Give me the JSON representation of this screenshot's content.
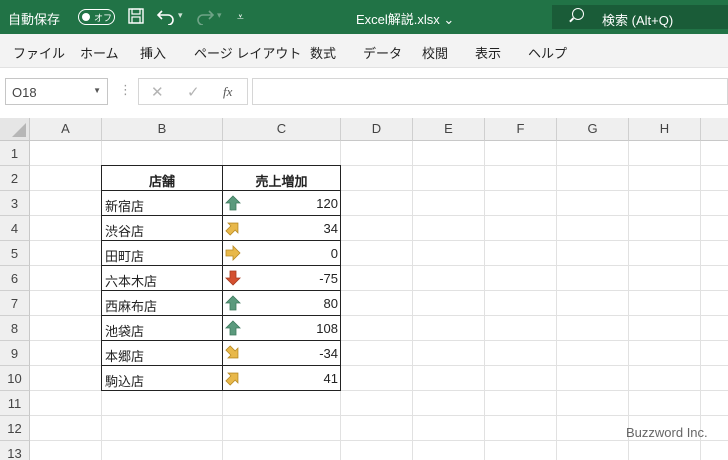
{
  "titlebar": {
    "autosave_label": "自動保存",
    "autosave_state": "オフ",
    "filename": "Excel解説.xlsx",
    "filename_caret": "⌄",
    "search_text": "検索 (Alt+Q)"
  },
  "ribbon": {
    "tabs": [
      "ファイル",
      "ホーム",
      "挿入",
      "ページ レイアウト",
      "数式",
      "データ",
      "校閲",
      "表示",
      "ヘルプ"
    ]
  },
  "formula_bar": {
    "name_box": "O18",
    "cancel": "✕",
    "enter": "✓",
    "fx": "fx",
    "content": ""
  },
  "sheet": {
    "columns": [
      "A",
      "B",
      "C",
      "D",
      "E",
      "F",
      "G",
      "H"
    ],
    "rows": [
      "1",
      "2",
      "3",
      "4",
      "5",
      "6",
      "7",
      "8",
      "9",
      "10",
      "11",
      "12",
      "13"
    ],
    "table": {
      "header": {
        "store": "店舗",
        "increase": "売上増加"
      },
      "rows": [
        {
          "store": "新宿店",
          "value": "120",
          "icon": "arrow-up-icon"
        },
        {
          "store": "渋谷店",
          "value": "34",
          "icon": "arrow-up-right-icon"
        },
        {
          "store": "田町店",
          "value": "0",
          "icon": "arrow-right-icon"
        },
        {
          "store": "六本木店",
          "value": "-75",
          "icon": "arrow-down-icon"
        },
        {
          "store": "西麻布店",
          "value": "80",
          "icon": "arrow-up-icon"
        },
        {
          "store": "池袋店",
          "value": "108",
          "icon": "arrow-up-icon"
        },
        {
          "store": "本郷店",
          "value": "-34",
          "icon": "arrow-down-right-icon"
        },
        {
          "store": "駒込店",
          "value": "41",
          "icon": "arrow-up-right-icon"
        }
      ]
    }
  },
  "watermark": "Buzzword Inc.",
  "colors": {
    "excel_green": "#217346",
    "arrow_green": "#5b9a7d",
    "arrow_yellow": "#e8b84a",
    "arrow_red": "#d4502f"
  }
}
